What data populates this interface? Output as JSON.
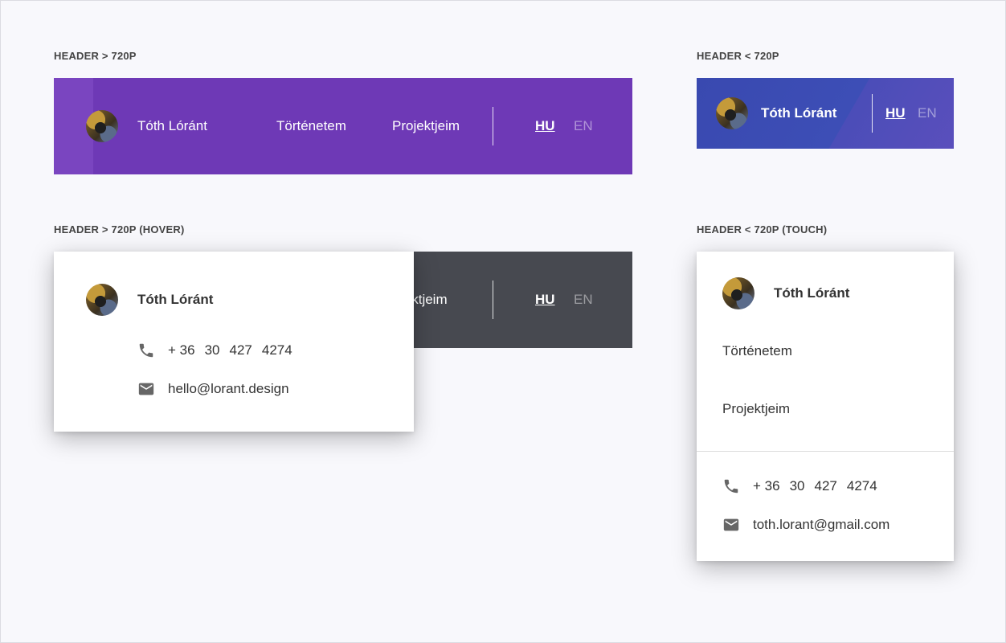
{
  "labels": {
    "desktop": "HEADER > 720P",
    "mobile": "HEADER < 720P",
    "desktop_hover": "HEADER > 720P (HOVER)",
    "mobile_touch": "HEADER < 720P (TOUCH)"
  },
  "header": {
    "name": "Tóth Lóránt",
    "nav": [
      "Történetem",
      "Projektjeim"
    ],
    "partial_nav": "jektjeim",
    "lang_active": "HU",
    "lang_inactive": "EN"
  },
  "hover_card": {
    "name": "Tóth Lóránt",
    "phone": [
      "+ 36",
      "30",
      "427",
      "4274"
    ],
    "email": "hello@lorant.design"
  },
  "touch_card": {
    "name": "Tóth Lóránt",
    "links": [
      "Történetem",
      "Projektjeim"
    ],
    "phone": [
      "+ 36",
      "30",
      "427",
      "4274"
    ],
    "email": "toth.lorant@gmail.com"
  },
  "icons": {
    "phone": "phone-icon",
    "email": "mail-icon"
  },
  "colors": {
    "purple": "#6e39b6",
    "indigo": "#3d4eb6",
    "dark": "#474950",
    "background": "#f8f8fc"
  }
}
